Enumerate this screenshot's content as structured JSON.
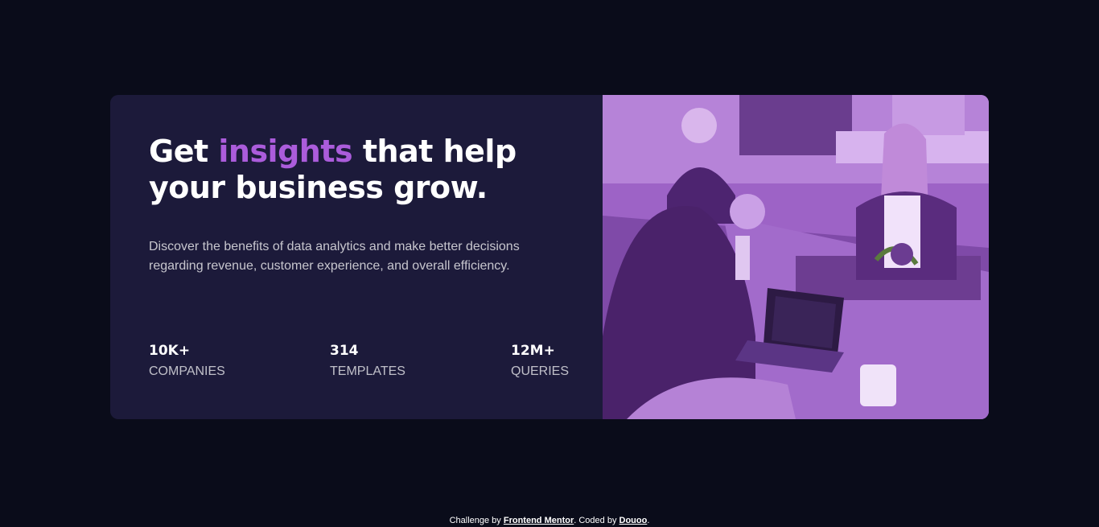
{
  "card": {
    "headline_part1": "Get ",
    "headline_accent": "insights",
    "headline_part2": " that help",
    "headline_line2": "your business grow.",
    "description": "Discover the benefits of data analytics and make better decisions regarding revenue, customer experience, and overall efficiency.",
    "stats": [
      {
        "value": "10K+",
        "label": "COMPANIES"
      },
      {
        "value": "314",
        "label": "TEMPLATES"
      },
      {
        "value": "12M+",
        "label": "QUERIES"
      }
    ],
    "image_description_icon": "photo-image"
  },
  "footer": {
    "prefix": "Challenge by ",
    "link1": "Frontend Mentor",
    "middle": ". Coded by ",
    "link2": "Douoo",
    "suffix": "."
  },
  "colors": {
    "background": "#0a0c1a",
    "card": "#1c1a3a",
    "accent": "#ab5cdb",
    "photo_tint": "#8a4fb4"
  }
}
